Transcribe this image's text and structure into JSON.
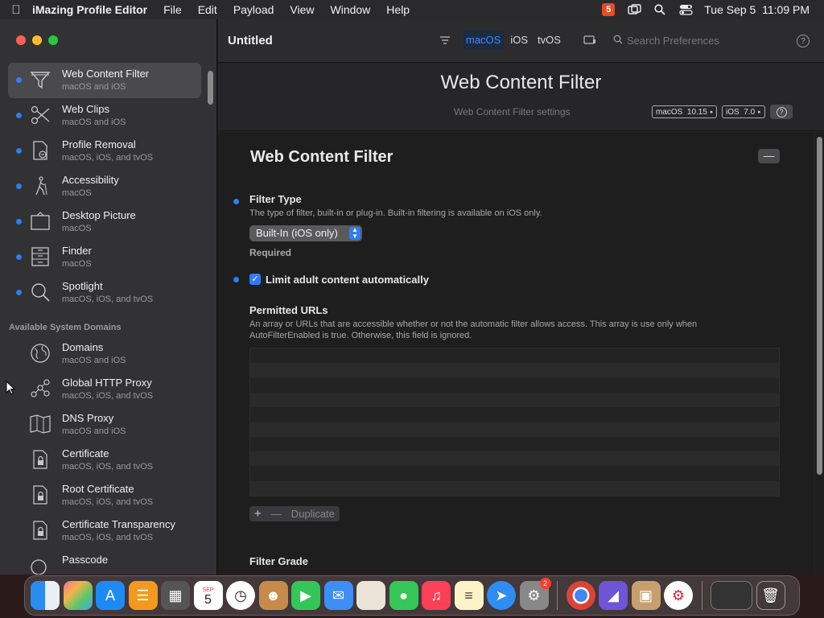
{
  "menubar": {
    "app_name": "iMazing Profile Editor",
    "items": [
      "File",
      "Edit",
      "Payload",
      "View",
      "Window",
      "Help"
    ],
    "datetime": "Tue Sep 5  11:09 PM",
    "html5_badge": "5"
  },
  "toolbar": {
    "doc_title": "Untitled",
    "platforms": [
      "macOS",
      "iOS",
      "tvOS"
    ],
    "active_platform": "macOS",
    "search_placeholder": "Search Preferences",
    "help_label": "?"
  },
  "sidebar": {
    "items": [
      {
        "title": "Web Content Filter",
        "sub": "macOS and iOS",
        "icon": "funnel-icon"
      },
      {
        "title": "Web Clips",
        "sub": "macOS and iOS",
        "icon": "scissors-icon"
      },
      {
        "title": "Profile Removal",
        "sub": "macOS, iOS, and tvOS",
        "icon": "profile-removal-icon"
      },
      {
        "title": "Accessibility",
        "sub": "macOS",
        "icon": "accessibility-icon"
      },
      {
        "title": "Desktop Picture",
        "sub": "macOS",
        "icon": "desktop-picture-icon"
      },
      {
        "title": "Finder",
        "sub": "macOS",
        "icon": "finder-icon"
      },
      {
        "title": "Spotlight",
        "sub": "macOS, iOS, and tvOS",
        "icon": "magnifier-icon"
      }
    ],
    "section_title": "Available System Domains",
    "domain_items": [
      {
        "title": "Domains",
        "sub": "macOS and iOS",
        "icon": "globe-icon"
      },
      {
        "title": "Global HTTP Proxy",
        "sub": "macOS, iOS, and tvOS",
        "icon": "proxy-icon"
      },
      {
        "title": "DNS Proxy",
        "sub": "macOS and iOS",
        "icon": "dns-map-icon"
      },
      {
        "title": "Certificate",
        "sub": "macOS, iOS, and tvOS",
        "icon": "certificate-lock-icon"
      },
      {
        "title": "Root Certificate",
        "sub": "macOS, iOS, and tvOS",
        "icon": "root-certificate-lock-icon"
      },
      {
        "title": "Certificate Transparency",
        "sub": "macOS, iOS, and tvOS",
        "icon": "certificate-transparency-lock-icon"
      },
      {
        "title": "Passcode",
        "sub": "",
        "icon": "passcode-icon"
      }
    ]
  },
  "header": {
    "title": "Web Content Filter",
    "subtitle": "Web Content Filter settings",
    "macos_badge": "macOS  10.15",
    "ios_badge": "iOS  7.0",
    "help": "?"
  },
  "payload": {
    "title": "Web Content Filter",
    "collapse_label": "—",
    "filter_type": {
      "label": "Filter Type",
      "description": "The type of filter, built-in or plug-in. Built-in filtering is available on iOS only.",
      "value": "Built-In (iOS only)",
      "required_label": "Required"
    },
    "limit_adult": {
      "label": "Limit adult content automatically",
      "checked": true
    },
    "permitted_urls": {
      "label": "Permitted URLs",
      "description_line1": "An array or URLs that are accessible whether or not the automatic filter allows access. This array is use only when",
      "description_line2": "AutoFilterEnabled is true. Otherwise, this field is ignored.",
      "add_label": "+",
      "remove_label": "—",
      "duplicate_label": "Duplicate"
    },
    "filter_grade": {
      "label": "Filter Grade"
    }
  },
  "dock": {
    "calendar_month": "SEP",
    "calendar_day": "5",
    "settings_badge": "2"
  },
  "colors": {
    "accent": "#2f7df6",
    "sidebar_bg": "#323234",
    "selected_bg": "#4a4a4c"
  }
}
